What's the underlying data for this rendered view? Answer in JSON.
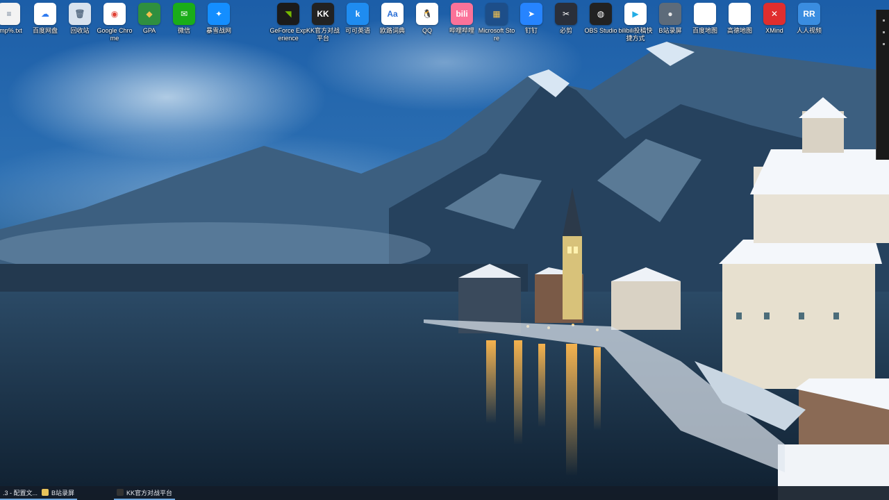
{
  "desktop": {
    "icons": [
      {
        "label": "emp%.txt",
        "name": "text-file-icon",
        "color": "#f3f3f3",
        "glyph": "≡",
        "text": "#6b7c93"
      },
      {
        "label": "百度网盘",
        "name": "baidu-netdisk-icon",
        "color": "#ffffff",
        "glyph": "☁",
        "text": "#2f7bf0"
      },
      {
        "label": "回收站",
        "name": "recycle-bin-icon",
        "color": "#d7e2ee",
        "glyph": "🗑",
        "text": "#5a6f86"
      },
      {
        "label": "Google Chrome",
        "name": "chrome-icon",
        "color": "#ffffff",
        "glyph": "◉",
        "text": "#e04236"
      },
      {
        "label": "GPA",
        "name": "shield-icon",
        "color": "#2f8f3f",
        "glyph": "◆",
        "text": "#f2c14e"
      },
      {
        "label": "微信",
        "name": "wechat-icon",
        "color": "#1aad19",
        "glyph": "✉",
        "text": "#ffffff"
      },
      {
        "label": "暴雪战网",
        "name": "battlenet-icon",
        "color": "#148eff",
        "glyph": "✦",
        "text": "#ffffff"
      },
      {
        "label": "GeForce Experience",
        "name": "geforce-icon",
        "color": "#1b1b1b",
        "glyph": "◥",
        "text": "#76b900"
      },
      {
        "label": "KK官方对战平台",
        "name": "kk-platform-icon",
        "color": "#222222",
        "glyph": "KK",
        "text": "#ffffff"
      },
      {
        "label": "可可英语",
        "name": "keke-english-icon",
        "color": "#1f8cf0",
        "glyph": "k",
        "text": "#ffffff"
      },
      {
        "label": "欧路词典",
        "name": "eudic-icon",
        "color": "#ffffff",
        "glyph": "Aa",
        "text": "#2a6fd6"
      },
      {
        "label": "QQ",
        "name": "qq-icon",
        "color": "#ffffff",
        "glyph": "🐧",
        "text": "#111111"
      },
      {
        "label": "哔哩哔哩",
        "name": "bilibili-icon",
        "color": "#fb7299",
        "glyph": "bili",
        "text": "#ffffff"
      },
      {
        "label": "Microsoft Store",
        "name": "microsoft-store-icon",
        "color": "#1d4e89",
        "glyph": "▦",
        "text": "#f2c14e"
      },
      {
        "label": "钉钉",
        "name": "dingtalk-icon",
        "color": "#2684ff",
        "glyph": "➤",
        "text": "#ffffff"
      },
      {
        "label": "必剪",
        "name": "bicut-icon",
        "color": "#2a2f3a",
        "glyph": "✂",
        "text": "#ffffff"
      },
      {
        "label": "OBS Studio",
        "name": "obs-icon",
        "color": "#222222",
        "glyph": "◍",
        "text": "#ffffff"
      },
      {
        "label": "bilibili投稿快捷方式",
        "name": "bilibili-upload-icon",
        "color": "#ffffff",
        "glyph": "▶",
        "text": "#23ade5"
      },
      {
        "label": "B站录屏",
        "name": "screen-recorder-icon",
        "color": "#5d6b7a",
        "glyph": "●",
        "text": "#e8e8e8"
      },
      {
        "label": "百度地图",
        "name": "file-icon",
        "color": "#ffffff",
        "glyph": "",
        "text": "#999999"
      },
      {
        "label": "高德地图",
        "name": "file-icon",
        "color": "#ffffff",
        "glyph": "",
        "text": "#999999"
      },
      {
        "label": "XMind",
        "name": "xmind-icon",
        "color": "#e02e2e",
        "glyph": "✕",
        "text": "#ffffff"
      },
      {
        "label": "人人视频",
        "name": "renren-video-icon",
        "color": "#3a8de0",
        "glyph": "RR",
        "text": "#ffffff"
      }
    ]
  },
  "taskbar": {
    "items": [
      {
        "label": ".3 - 配置文...",
        "color": "#d9d9d9"
      },
      {
        "label": "B站录屏",
        "color": "#e8c35a"
      },
      {
        "label": "KK官方对战平台",
        "color": "#333333"
      }
    ]
  }
}
